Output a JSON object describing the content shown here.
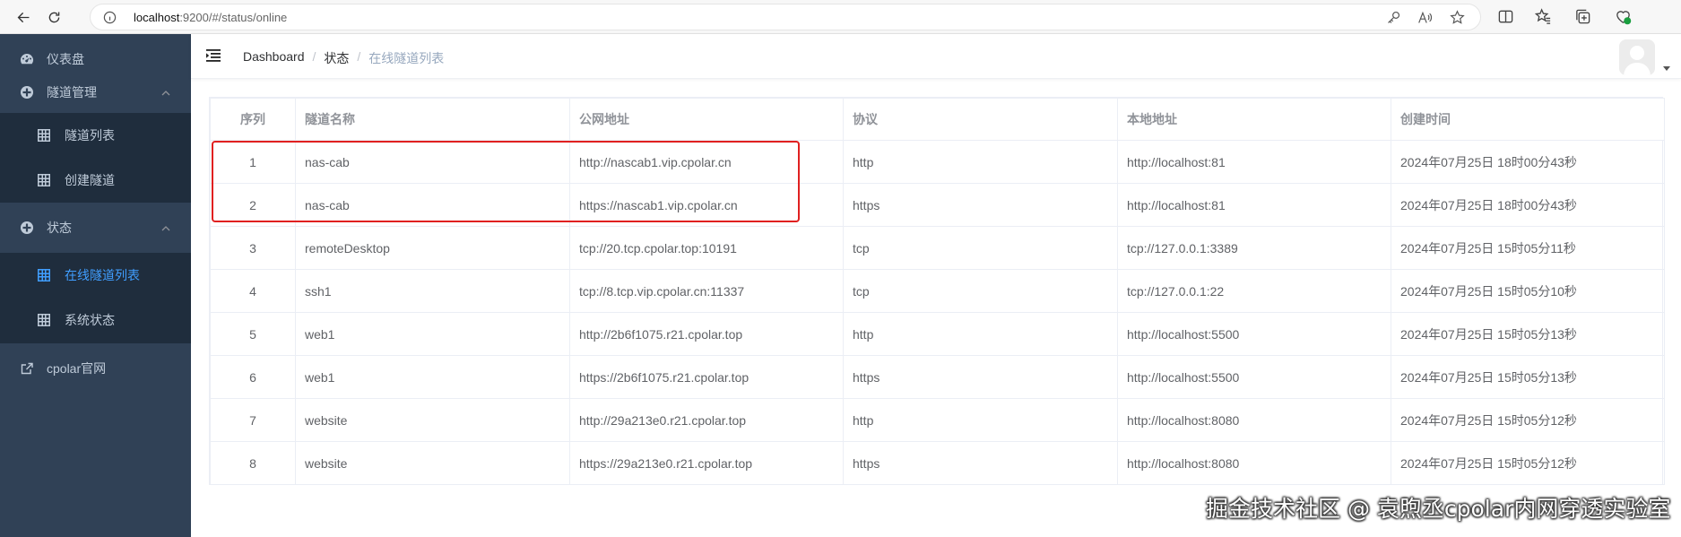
{
  "browser": {
    "url_host": "localhost",
    "url_rest": ":9200/#/status/online"
  },
  "sidebar": {
    "items": [
      {
        "label": "仪表盘",
        "icon": "dashboard-icon"
      },
      {
        "label": "隧道管理",
        "icon": "tunnel-manage-icon",
        "children": [
          {
            "label": "隧道列表",
            "icon": "table-icon"
          },
          {
            "label": "创建隧道",
            "icon": "table-icon"
          }
        ]
      },
      {
        "label": "状态",
        "icon": "status-icon",
        "children": [
          {
            "label": "在线隧道列表",
            "icon": "table-icon",
            "active": true
          },
          {
            "label": "系统状态",
            "icon": "table-icon"
          }
        ]
      },
      {
        "label": "cpolar官网",
        "icon": "external-link-icon"
      }
    ],
    "bg_color": "#304156",
    "active_color": "#409eff"
  },
  "breadcrumb": {
    "items": [
      "Dashboard",
      "状态",
      "在线隧道列表"
    ]
  },
  "table": {
    "columns": [
      "序列",
      "隧道名称",
      "公网地址",
      "协议",
      "本地地址",
      "创建时间"
    ],
    "rows": [
      [
        "1",
        "nas-cab",
        "http://nascab1.vip.cpolar.cn",
        "http",
        "http://localhost:81",
        "2024年07月25日 18时00分43秒"
      ],
      [
        "2",
        "nas-cab",
        "https://nascab1.vip.cpolar.cn",
        "https",
        "http://localhost:81",
        "2024年07月25日 18时00分43秒"
      ],
      [
        "3",
        "remoteDesktop",
        "tcp://20.tcp.cpolar.top:10191",
        "tcp",
        "tcp://127.0.0.1:3389",
        "2024年07月25日 15时05分11秒"
      ],
      [
        "4",
        "ssh1",
        "tcp://8.tcp.vip.cpolar.cn:11337",
        "tcp",
        "tcp://127.0.0.1:22",
        "2024年07月25日 15时05分10秒"
      ],
      [
        "5",
        "web1",
        "http://2b6f1075.r21.cpolar.top",
        "http",
        "http://localhost:5500",
        "2024年07月25日 15时05分13秒"
      ],
      [
        "6",
        "web1",
        "https://2b6f1075.r21.cpolar.top",
        "https",
        "http://localhost:5500",
        "2024年07月25日 15时05分13秒"
      ],
      [
        "7",
        "website",
        "http://29a213e0.r21.cpolar.top",
        "http",
        "http://localhost:8080",
        "2024年07月25日 15时05分12秒"
      ],
      [
        "8",
        "website",
        "https://29a213e0.r21.cpolar.top",
        "https",
        "http://localhost:8080",
        "2024年07月25日 15时05分12秒"
      ]
    ]
  },
  "watermark": "掘金技术社区 @ 袁煦丞cpolar内网穿透实验室"
}
